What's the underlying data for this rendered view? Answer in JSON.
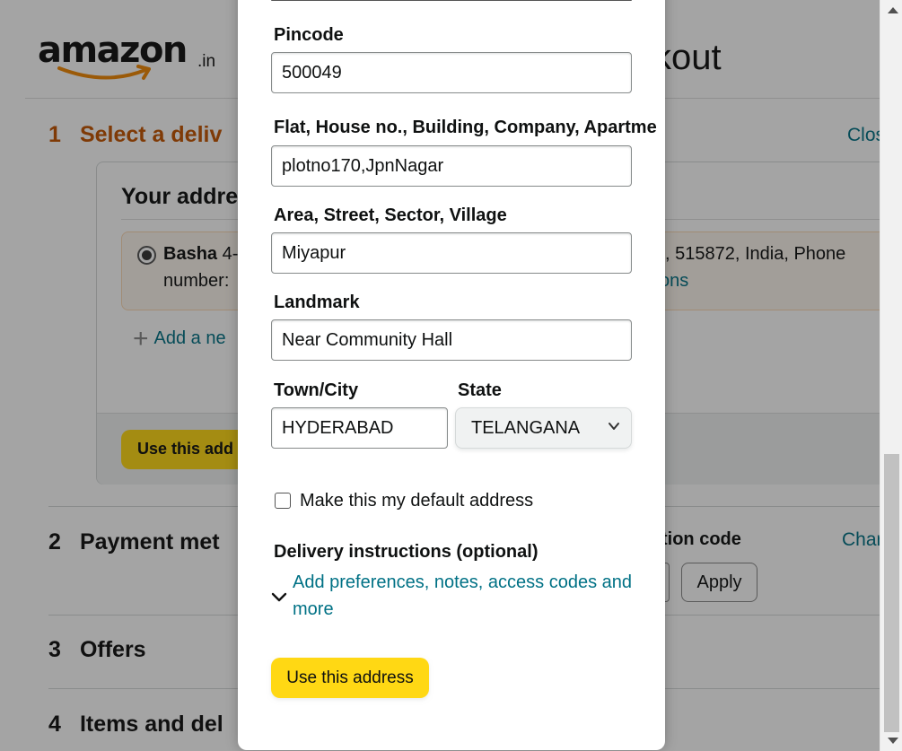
{
  "background": {
    "logo": {
      "text": "amazon",
      "suffix": ".in"
    },
    "page_title_visible": "kout",
    "step1": {
      "number": "1",
      "label": "Select a deliv",
      "close_link": "Clos"
    },
    "address_section": {
      "heading": "Your addre",
      "address": {
        "name": "Basha",
        "line1_rest": "4-",
        "line1_tail": ", 515872, India, Phone",
        "line2": "number:",
        "link_fragment": "ons"
      },
      "add_new": "Add a ne",
      "use_button": "Use this add"
    },
    "step2": {
      "number": "2",
      "label": "Payment met",
      "promo_label": "tion code",
      "change_link": "Char",
      "apply_button": "Apply"
    },
    "step3": {
      "number": "3",
      "label": "Offers"
    },
    "step4": {
      "number": "4",
      "label": "Items and del"
    }
  },
  "modal": {
    "form": {
      "pincode": {
        "label": "Pincode",
        "value": "500049"
      },
      "flat": {
        "label": "Flat, House no., Building, Company, Apartme",
        "value": "plotno170,JpnNagar"
      },
      "area": {
        "label": "Area, Street, Sector, Village",
        "value": "Miyapur"
      },
      "landmark": {
        "label": "Landmark",
        "value": "Near Community Hall"
      },
      "city": {
        "label": "Town/City",
        "value": "HYDERABAD"
      },
      "state": {
        "label": "State",
        "value": "TELANGANA"
      },
      "default_checkbox": {
        "label": "Make this my default address",
        "checked": false
      },
      "delivery_instructions": {
        "label": "Delivery instructions (optional)",
        "link": "Add preferences, notes, access codes and more"
      }
    },
    "submit_button": "Use this address"
  },
  "colors": {
    "accent_yellow": "#ffd814",
    "link_teal": "#007185",
    "step_orange": "#c45500"
  },
  "icons": {
    "chevron": "chevron-down-icon",
    "plus": "plus-icon",
    "scroll": "scroll-arrow-icon"
  }
}
